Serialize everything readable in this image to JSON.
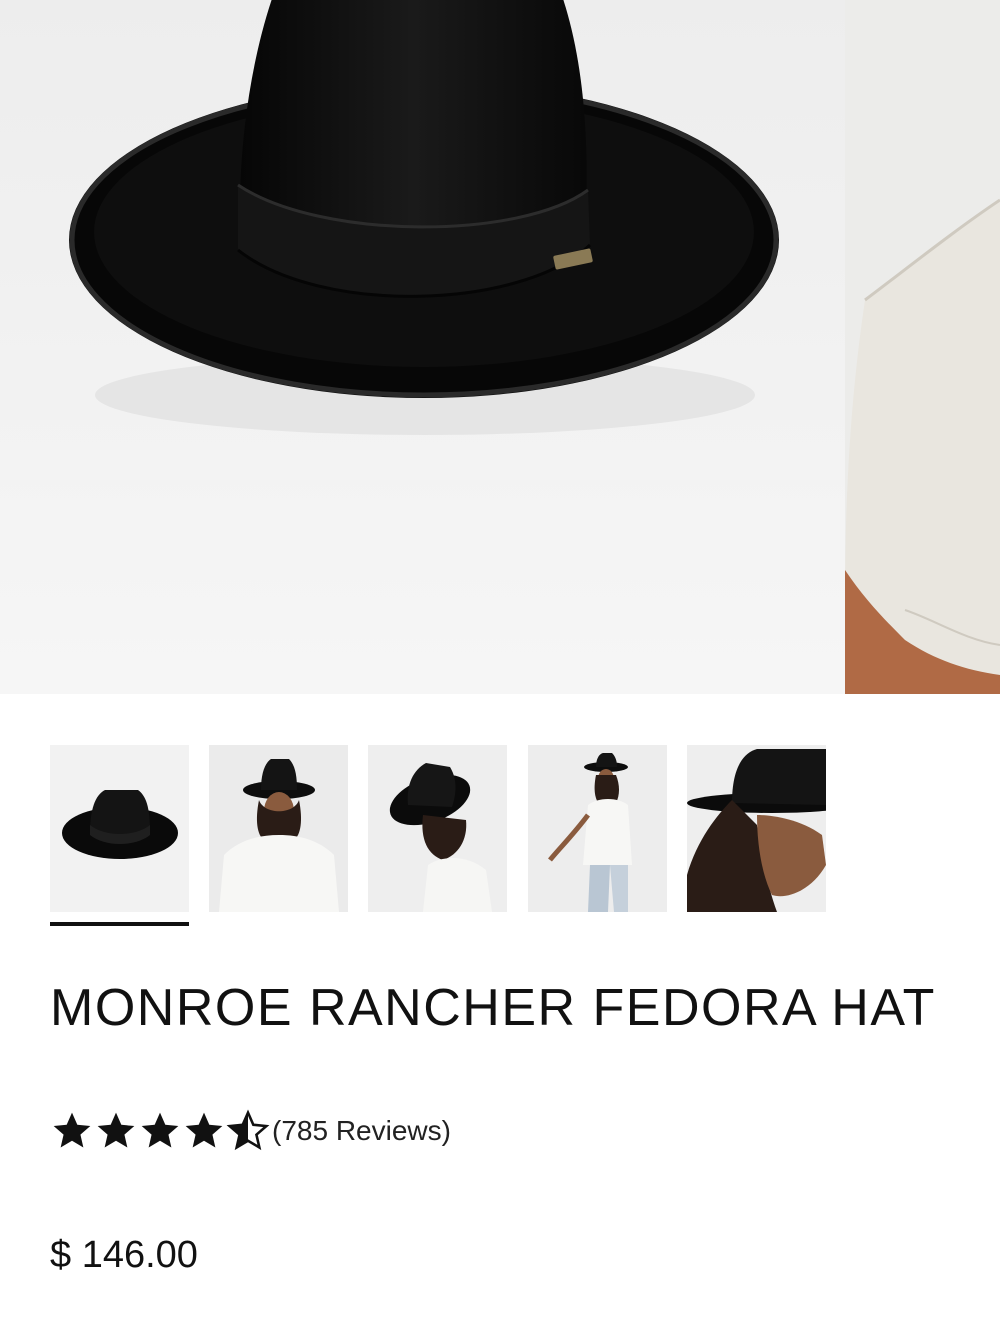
{
  "product": {
    "title": "MONROE RANCHER FEDORA HAT",
    "price": "$ 146.00",
    "rating": 4.5,
    "rating_max": 5,
    "reviews_label": "(785 Reviews)"
  },
  "gallery": {
    "selected_index": 0,
    "thumbnails": [
      {
        "name": "hat-product-shot"
      },
      {
        "name": "model-front-view"
      },
      {
        "name": "model-looking-down"
      },
      {
        "name": "model-walking"
      },
      {
        "name": "model-profile-closeup"
      }
    ]
  },
  "colors": {
    "text": "#111111",
    "hat": "#0b0b0b",
    "photo_background": "#f0f0f0"
  }
}
